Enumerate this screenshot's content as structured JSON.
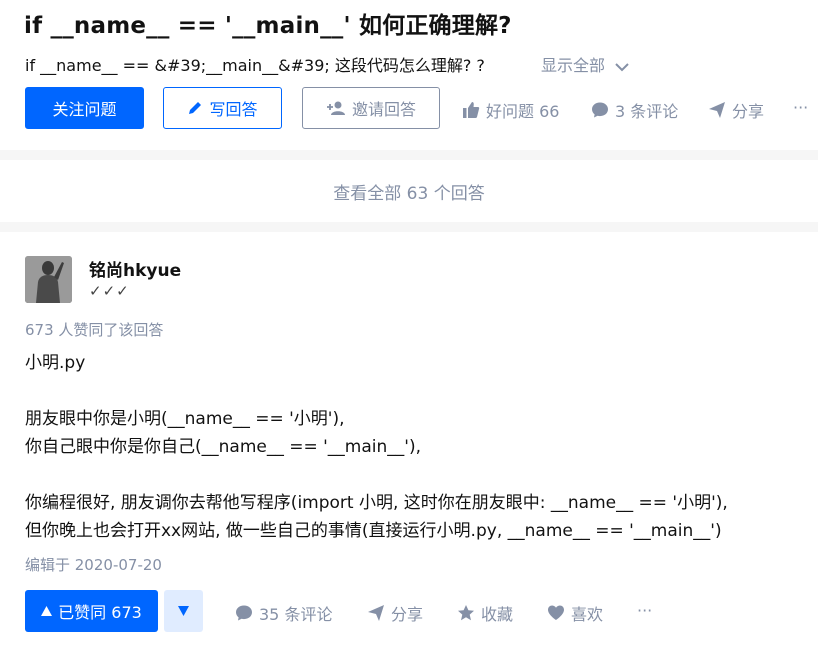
{
  "question": {
    "title": "if __name__ == '__main__' 如何正确理解?",
    "detail": "if __name__ == &#39;__main__&#39; 这段代码怎么理解? ?",
    "show_all": "显示全部"
  },
  "buttons": {
    "follow": "关注问题",
    "write": "写回答",
    "invite": "邀请回答"
  },
  "actions": {
    "good_question": "好问题 66",
    "comments": "3 条评论",
    "share": "分享",
    "more": "···"
  },
  "view_all": "查看全部 63 个回答",
  "answer": {
    "author_name": "铭尚hkyue",
    "author_badge": "✓✓✓",
    "vote_info": "673 人赞同了该回答",
    "lines": [
      "小明.py",
      "朋友眼中你是小明(__name__ == '小明'),",
      "你自己眼中你是你自己(__name__ == '__main__'),",
      "你编程很好, 朋友调你去帮他写程序(import 小明, 这时你在朋友眼中: __name__ == '小明'),",
      "但你晚上也会打开xx网站, 做一些自己的事情(直接运行小明.py, __name__ == '__main__')"
    ],
    "edit_time": "编辑于 2020-07-20",
    "agree": "已赞同 673",
    "comments": "35 条评论",
    "share": "分享",
    "favorite": "收藏",
    "like": "喜欢",
    "more": "···"
  },
  "colors": {
    "brand": "#0066ff",
    "meta": "#8590a6",
    "text": "#121212"
  }
}
